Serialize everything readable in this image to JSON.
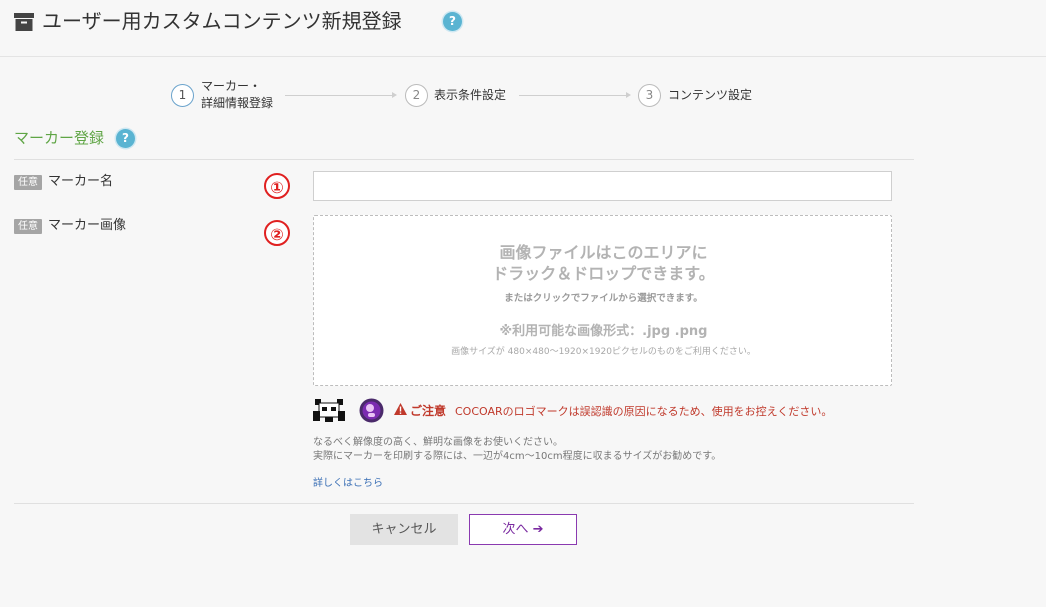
{
  "header": {
    "title": "ユーザー用カスタムコンテンツ新規登録",
    "help_glyph": "?"
  },
  "steps": [
    {
      "number": "1",
      "label_line1": "マーカー・",
      "label_line2": "詳細情報登録",
      "active": true
    },
    {
      "number": "2",
      "label_line1": "表示条件設定",
      "active": false
    },
    {
      "number": "3",
      "label_line1": "コンテンツ設定",
      "active": false
    }
  ],
  "section": {
    "title": "マーカー登録",
    "help_glyph": "?"
  },
  "fields": [
    {
      "badge": "任意",
      "label": "マーカー名",
      "marker": "①",
      "value": "",
      "placeholder": ""
    },
    {
      "badge": "任意",
      "label": "マーカー画像",
      "marker": "②"
    }
  ],
  "dropzone": {
    "line1": "画像ファイルはこのエリアに",
    "line2": "ドラック＆ドロップできます。",
    "line3": "またはクリックでファイルから選択できます。",
    "format": "※利用可能な画像形式：.jpg .png",
    "size": "画像サイズが 480×480～1920×1920ピクセルのものをご利用ください。"
  },
  "warning": {
    "title": "ご注意",
    "text": "COCOARのロゴマークは誤認識の原因になるため、使用をお控えください。"
  },
  "notes": [
    "なるべく解像度の高く、鮮明な画像をお使いください。",
    "実際にマーカーを印刷する際には、一辺が4cm～10cm程度に収まるサイズがお勧めです。"
  ],
  "more_link": "詳しくはこちら",
  "buttons": {
    "cancel": "キャンセル",
    "next": "次へ",
    "next_icon": "➔"
  },
  "colors": {
    "section_title": "#5fa545",
    "help": "#5ab4d2",
    "warning": "#c0392b",
    "next_button": "#8a3ab0",
    "marker_number": "#e02020"
  }
}
